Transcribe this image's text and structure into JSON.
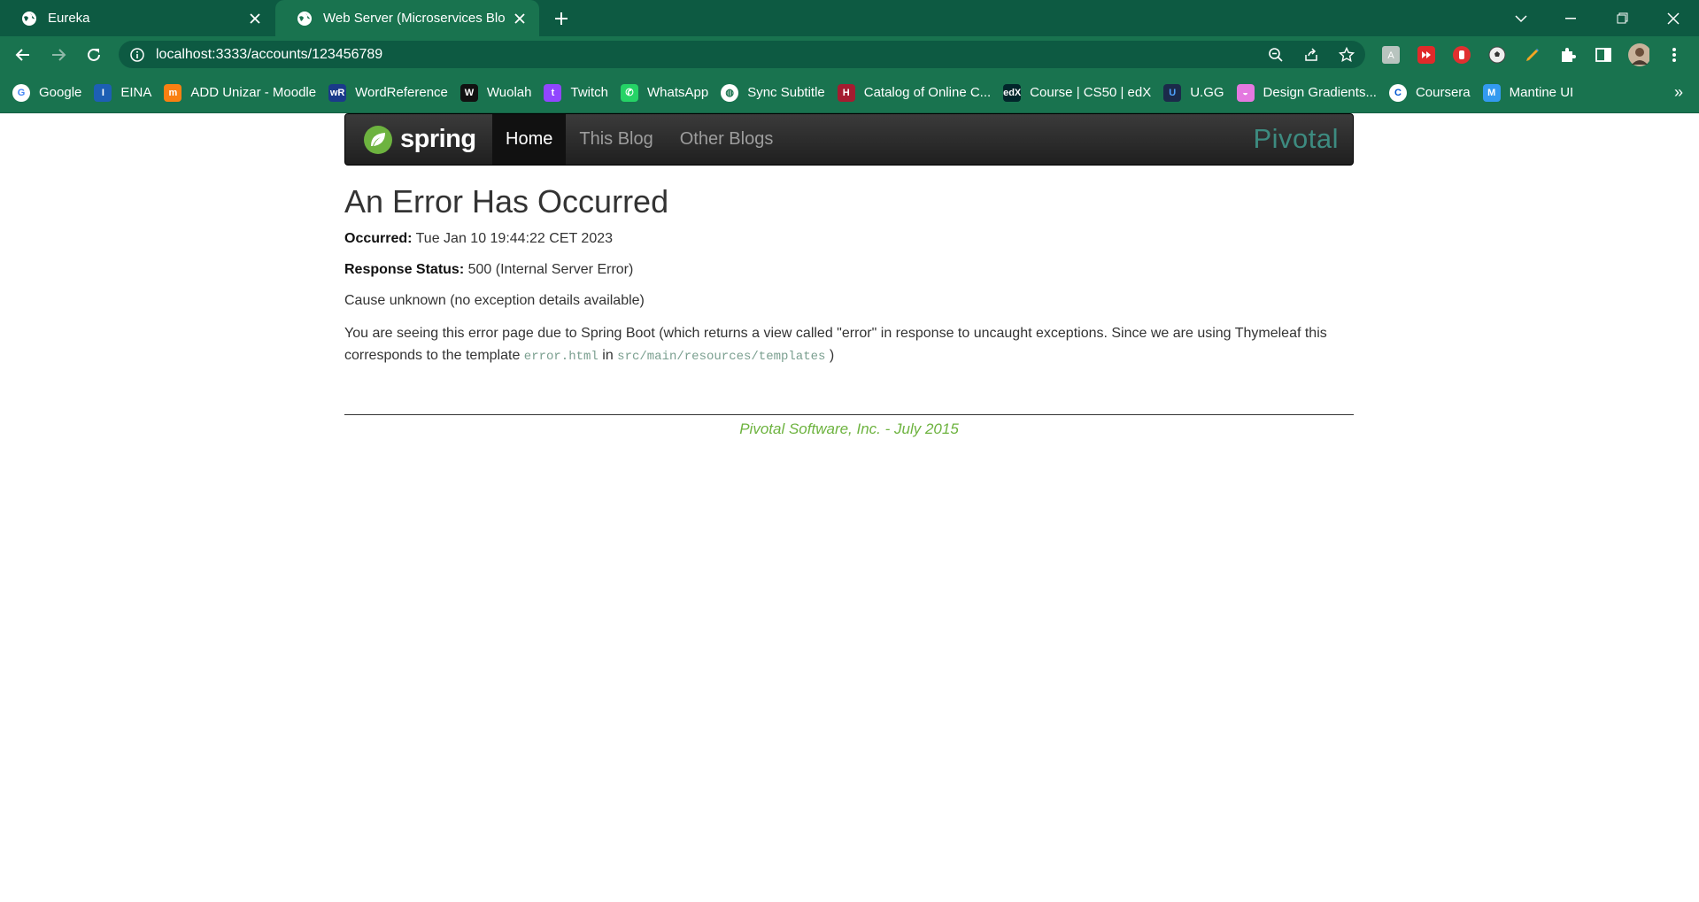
{
  "browser": {
    "tabs": [
      {
        "title": "Eureka",
        "active": false
      },
      {
        "title": "Web Server (Microservices Blog D",
        "active": true
      }
    ],
    "url": "localhost:3333/accounts/123456789",
    "bookmarks": [
      {
        "label": "Google",
        "icon": "google-icon"
      },
      {
        "label": "EINA",
        "icon": "eina-icon"
      },
      {
        "label": "ADD Unizar - Moodle",
        "icon": "moodle-icon"
      },
      {
        "label": "WordReference",
        "icon": "wordreference-icon"
      },
      {
        "label": "Wuolah",
        "icon": "wuolah-icon"
      },
      {
        "label": "Twitch",
        "icon": "twitch-icon"
      },
      {
        "label": "WhatsApp",
        "icon": "whatsapp-icon"
      },
      {
        "label": "Sync Subtitle",
        "icon": "globe-icon"
      },
      {
        "label": "Catalog of Online C...",
        "icon": "harvard-icon"
      },
      {
        "label": "Course | CS50 | edX",
        "icon": "edx-icon"
      },
      {
        "label": "U.GG",
        "icon": "ugg-icon"
      },
      {
        "label": "Design Gradients...",
        "icon": "gradients-icon"
      },
      {
        "label": "Coursera",
        "icon": "coursera-icon"
      },
      {
        "label": "Mantine UI",
        "icon": "mantine-icon"
      }
    ],
    "bookmarks_more": "»",
    "colors": {
      "frame": "#0d5a42",
      "toolbar": "#19734f"
    }
  },
  "navbar": {
    "logo_text": "spring",
    "links": [
      "Home",
      "This Blog",
      "Other Blogs"
    ],
    "brand_right": "Pivotal"
  },
  "content": {
    "heading": "An Error Has Occurred",
    "occurred_label": "Occurred:",
    "occurred_value": "Tue Jan 10 19:44:22 CET 2023",
    "status_label": "Response Status:",
    "status_value": "500 (Internal Server Error)",
    "cause": "Cause unknown (no exception details available)",
    "explanation_part1": "You are seeing this error page due to Spring Boot (which returns a view called \"error\" in response to uncaught exceptions. Since we are using Thymeleaf this corresponds to the template",
    "template_file": "error.html",
    "in_word": "in",
    "template_dir": "src/main/resources/templates",
    "close_paren": ")"
  },
  "footer": {
    "text": "Pivotal Software, Inc. - July 2015"
  }
}
